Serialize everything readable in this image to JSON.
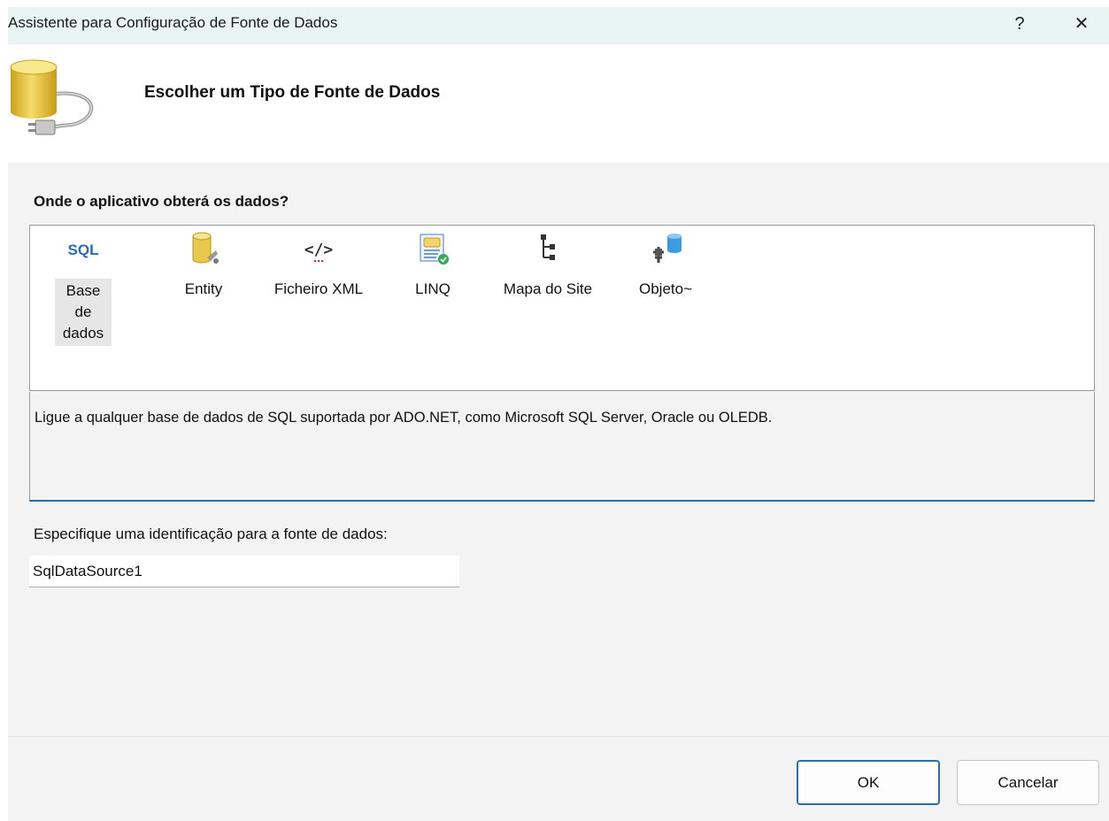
{
  "window": {
    "title": "Assistente para Configuração de Fonte de Dados",
    "help_label": "?",
    "close_label": "✕"
  },
  "header": {
    "title": "Escolher um Tipo de Fonte de Dados",
    "icon": "database-plug-icon"
  },
  "source_types": {
    "question": "Onde o aplicativo obterá os dados?",
    "selected": "Base de dados",
    "items": [
      {
        "label": "Base de dados",
        "icon": "sql-icon"
      },
      {
        "label": "Entity",
        "icon": "entity-database-icon"
      },
      {
        "label": "Ficheiro XML",
        "icon": "xml-icon"
      },
      {
        "label": "LINQ",
        "icon": "linq-icon"
      },
      {
        "label": "Mapa do Site",
        "icon": "sitemap-icon"
      },
      {
        "label": "Objeto~",
        "icon": "object-icon"
      }
    ],
    "description": "Ligue a qualquer base de dados de SQL suportada por ADO.NET, como Microsoft SQL Server, Oracle ou OLEDB."
  },
  "id_field": {
    "label": "Especifique uma identificação para a fonte de dados:",
    "value": "SqlDataSource1"
  },
  "buttons": {
    "ok": "OK",
    "cancel": "Cancelar"
  },
  "colors": {
    "titlebar": "#e8f5f3",
    "accent": "#2e6ea8",
    "panel": "#f3f3f3"
  }
}
